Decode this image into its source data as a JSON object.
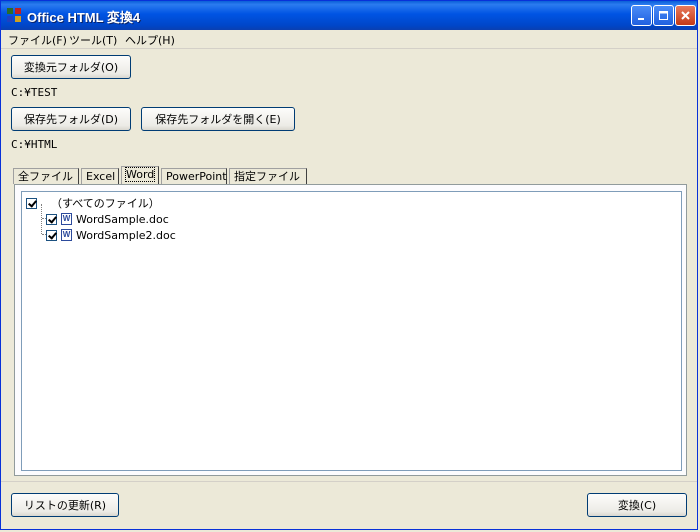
{
  "window": {
    "title": "Office HTML 変換4"
  },
  "menu": [
    "ファイル(F)",
    "ツール(T)",
    "ヘルプ(H)"
  ],
  "source": {
    "button": "変換元フォルダ(O)",
    "path": "C:¥TEST"
  },
  "dest": {
    "button": "保存先フォルダ(D)",
    "open_button": "保存先フォルダを開く(E)",
    "path": "C:¥HTML"
  },
  "tabs": [
    {
      "label": "全ファイル",
      "active": false
    },
    {
      "label": "Excel",
      "active": false
    },
    {
      "label": "Word",
      "active": true
    },
    {
      "label": "PowerPoint",
      "active": false
    },
    {
      "label": "指定ファイル",
      "active": false
    }
  ],
  "tree": {
    "root": {
      "label": "（すべてのファイル）",
      "checked": true
    },
    "files": [
      {
        "name": "WordSample.doc",
        "checked": true,
        "icon": "word-doc-icon"
      },
      {
        "name": "WordSample2.doc",
        "checked": true,
        "icon": "word-doc-icon"
      }
    ]
  },
  "footer": {
    "refresh": "リストの更新(R)",
    "convert": "変換(C)"
  },
  "colors": {
    "titlebar": "#0054e3",
    "face": "#ece9d8",
    "close": "#c43a16"
  }
}
